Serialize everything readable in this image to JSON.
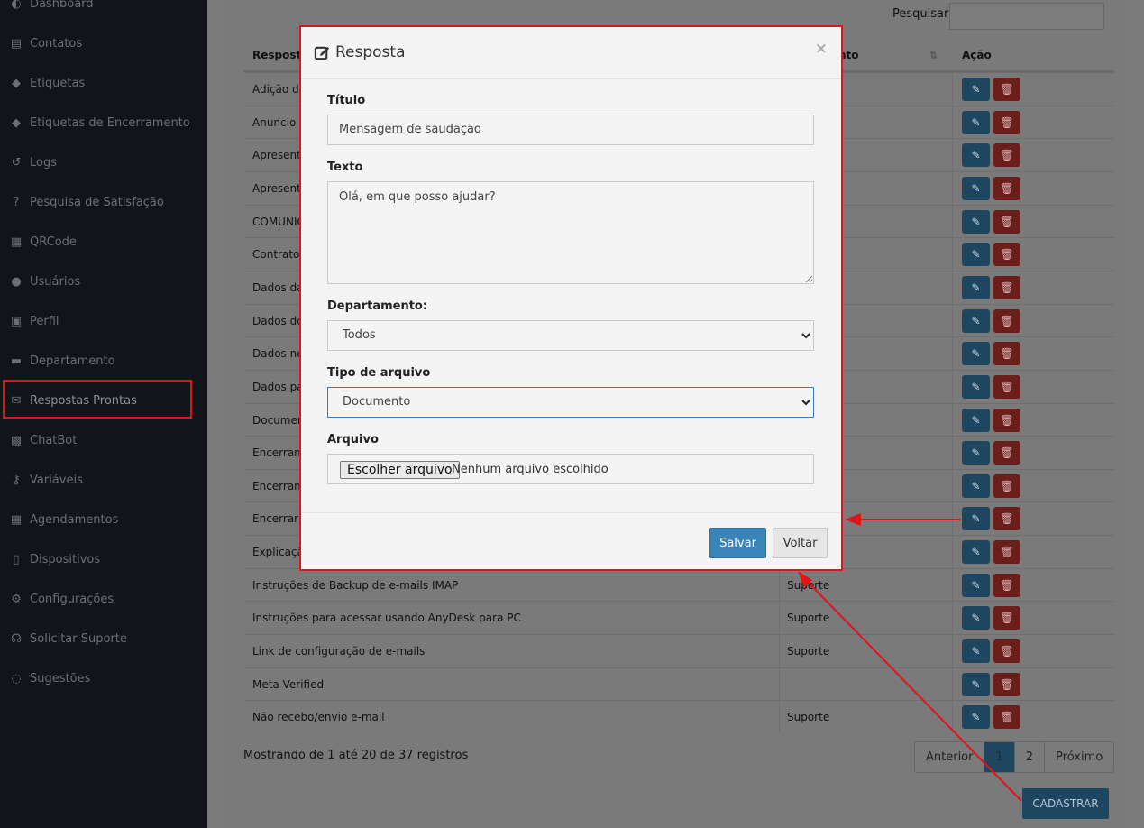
{
  "sidebar": {
    "items": [
      {
        "label": "Dashboard",
        "icon": "dashboard-icon"
      },
      {
        "label": "Contatos",
        "icon": "address-book-icon"
      },
      {
        "label": "Etiquetas",
        "icon": "tags-icon"
      },
      {
        "label": "Etiquetas de Encerramento",
        "icon": "tags-icon"
      },
      {
        "label": "Logs",
        "icon": "history-icon"
      },
      {
        "label": "Pesquisa de Satisfação",
        "icon": "question-icon"
      },
      {
        "label": "QRCode",
        "icon": "qrcode-icon"
      },
      {
        "label": "Usuários",
        "icon": "user-icon"
      },
      {
        "label": "Perfil",
        "icon": "lock-icon"
      },
      {
        "label": "Departamento",
        "icon": "folder-icon"
      },
      {
        "label": "Respostas Prontas",
        "icon": "envelope-icon"
      },
      {
        "label": "ChatBot",
        "icon": "robot-icon"
      },
      {
        "label": "Variáveis",
        "icon": "key-icon"
      },
      {
        "label": "Agendamentos",
        "icon": "calendar-icon"
      },
      {
        "label": "Dispositivos",
        "icon": "mobile-icon"
      },
      {
        "label": "Configurações",
        "icon": "cogs-icon"
      },
      {
        "label": "Solicitar Suporte",
        "icon": "headset-icon"
      },
      {
        "label": "Sugestões",
        "icon": "lightbulb-icon"
      }
    ]
  },
  "search": {
    "label": "Pesquisar",
    "value": ""
  },
  "table": {
    "headers": {
      "name": "Resposta",
      "dept": "nto",
      "action": "Ação"
    },
    "rows": [
      {
        "name": "Adição de",
        "dept": ""
      },
      {
        "name": "Anuncio F",
        "dept": ""
      },
      {
        "name": "Apresenta",
        "dept": ""
      },
      {
        "name": "Apresenta",
        "dept": ""
      },
      {
        "name": "COMUNIC",
        "dept": ""
      },
      {
        "name": "Contrato",
        "dept": ""
      },
      {
        "name": "Dados da",
        "dept": ""
      },
      {
        "name": "Dados do",
        "dept": ""
      },
      {
        "name": "Dados ne",
        "dept": ""
      },
      {
        "name": "Dados par",
        "dept": ""
      },
      {
        "name": "Documen",
        "dept": ""
      },
      {
        "name": "Encerram",
        "dept": ""
      },
      {
        "name": "Encerram",
        "dept": ""
      },
      {
        "name": "Encerrar C",
        "dept": ""
      },
      {
        "name": "Explicaçã",
        "dept": ""
      },
      {
        "name": "Instruções de Backup de e-mails IMAP",
        "dept": "Suporte"
      },
      {
        "name": "Instruções para acessar usando AnyDesk para PC",
        "dept": "Suporte"
      },
      {
        "name": "Link de configuração de e-mails",
        "dept": "Suporte"
      },
      {
        "name": "Meta Verified",
        "dept": ""
      },
      {
        "name": "Não recebo/envio e-mail",
        "dept": "Suporte"
      }
    ]
  },
  "footer": {
    "info": "Mostrando de 1 até 20 de 37 registros",
    "pages": [
      "Anterior",
      "1",
      "2",
      "Próximo"
    ],
    "current_page": "1",
    "cadastrar": "CADASTRAR"
  },
  "modal": {
    "title": "Resposta",
    "close": "×",
    "titulo_label": "Título",
    "titulo_value": "Mensagem de saudação",
    "texto_label": "Texto",
    "texto_value": "Olá, em que posso ajudar?",
    "departamento_label": "Departamento:",
    "departamento_value": "Todos",
    "tipo_label": "Tipo de arquivo",
    "tipo_value": "Documento",
    "arquivo_label": "Arquivo",
    "arquivo_button": "Escolher arquivo",
    "arquivo_status": "Nenhum arquivo escolhido",
    "salvar": "Salvar",
    "voltar": "Voltar"
  },
  "colors": {
    "annotation_red": "#e0141b",
    "primary_blue": "#3b84b7",
    "danger_red": "#6c1e1a"
  }
}
